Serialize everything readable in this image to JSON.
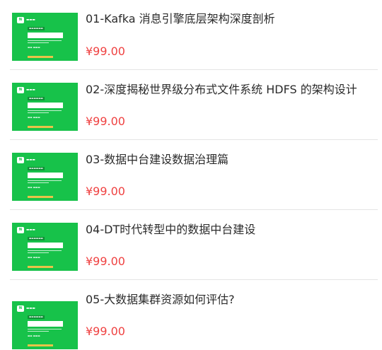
{
  "colors": {
    "thumbnail_green": "#17c24a",
    "price_red": "#ef4141",
    "title_text": "#2b2b2b",
    "separator": "#e4e4e4"
  },
  "courses": [
    {
      "title": "01-Kafka 消息引擎底层架构深度剖析",
      "price": "¥99.00"
    },
    {
      "title": "02-深度揭秘世界级分布式文件系统 HDFS 的架构设计",
      "price": "¥99.00"
    },
    {
      "title": "03-数据中台建设数据治理篇",
      "price": "¥99.00"
    },
    {
      "title": "04-DT时代转型中的数据中台建设",
      "price": "¥99.00"
    },
    {
      "title": "05-大数据集群资源如何评估?",
      "price": "¥99.00"
    }
  ]
}
